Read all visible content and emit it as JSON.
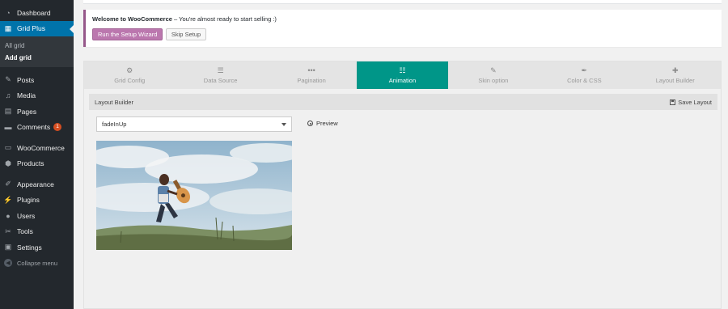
{
  "sidebar": {
    "dashboard": "Dashboard",
    "grid_plus": "Grid Plus",
    "submenu": [
      "All grid",
      "Add grid"
    ],
    "posts": "Posts",
    "media": "Media",
    "pages": "Pages",
    "comments": "Comments",
    "comments_count": "1",
    "woocommerce": "WooCommerce",
    "products": "Products",
    "appearance": "Appearance",
    "plugins": "Plugins",
    "users": "Users",
    "tools": "Tools",
    "settings": "Settings",
    "collapse": "Collapse menu"
  },
  "notice": {
    "title": "Welcome to WooCommerce",
    "message": " – You're almost ready to start selling :)",
    "setup_button": "Run the Setup Wizard",
    "skip_button": "Skip Setup"
  },
  "tabs": [
    {
      "label": "Grid Config",
      "icon": "gears-icon"
    },
    {
      "label": "Data Source",
      "icon": "database-icon"
    },
    {
      "label": "Pagination",
      "icon": "ellipsis-icon"
    },
    {
      "label": "Animation",
      "icon": "sliders-icon",
      "active": true
    },
    {
      "label": "Skin option",
      "icon": "brush-icon"
    },
    {
      "label": "Color & CSS",
      "icon": "eyedropper-icon"
    },
    {
      "label": "Layout Builder",
      "icon": "puzzle-icon"
    }
  ],
  "layout_builder": {
    "title": "Layout Builder",
    "save_label": "Save Layout",
    "animation_value": "fadeInUp",
    "preview_label": "Preview"
  },
  "colors": {
    "sidebar_bg": "#23282d",
    "active_menu": "#0073aa",
    "active_tab": "#009688",
    "woo_purple": "#bb77ae"
  }
}
